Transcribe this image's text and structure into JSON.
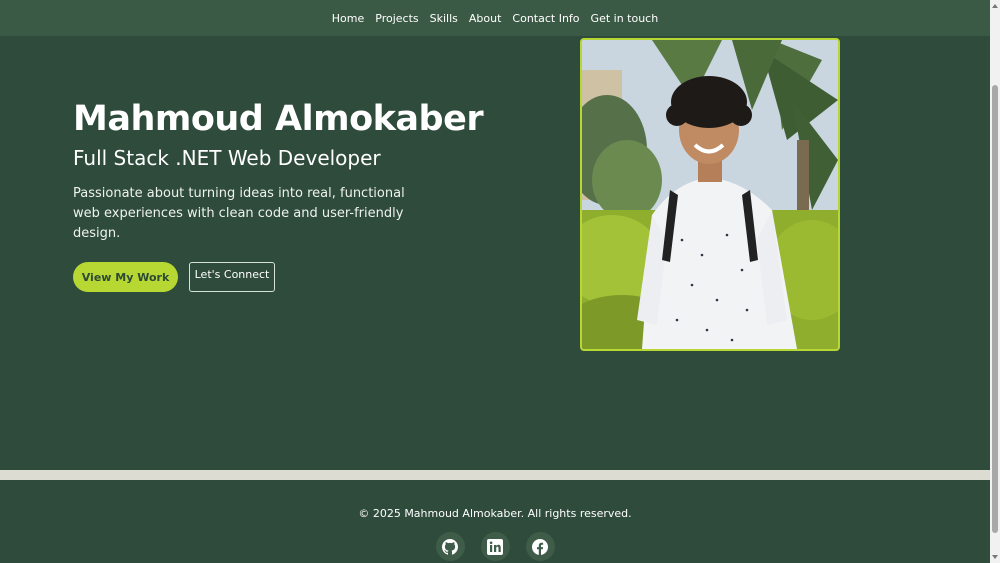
{
  "nav": {
    "items": [
      {
        "label": "Home"
      },
      {
        "label": "Projects"
      },
      {
        "label": "Skills"
      },
      {
        "label": "About"
      },
      {
        "label": "Contact Info"
      },
      {
        "label": "Get in touch"
      }
    ]
  },
  "hero": {
    "name": "Mahmoud Almokaber",
    "role": "Full Stack .NET Web Developer",
    "description": "Passionate about turning ideas into real, functional web experiences with clean code and user-friendly design.",
    "primary_button": "View My Work",
    "secondary_button": "Let's Connect"
  },
  "footer": {
    "copyright": "© 2025 Mahmoud Almokaber. All rights reserved.",
    "socials": [
      "github-icon",
      "linkedin-icon",
      "facebook-icon"
    ]
  },
  "colors": {
    "background": "#2f4b3c",
    "nav": "#3b5a45",
    "accent": "#b7d833",
    "separator": "#dcdcd2"
  }
}
